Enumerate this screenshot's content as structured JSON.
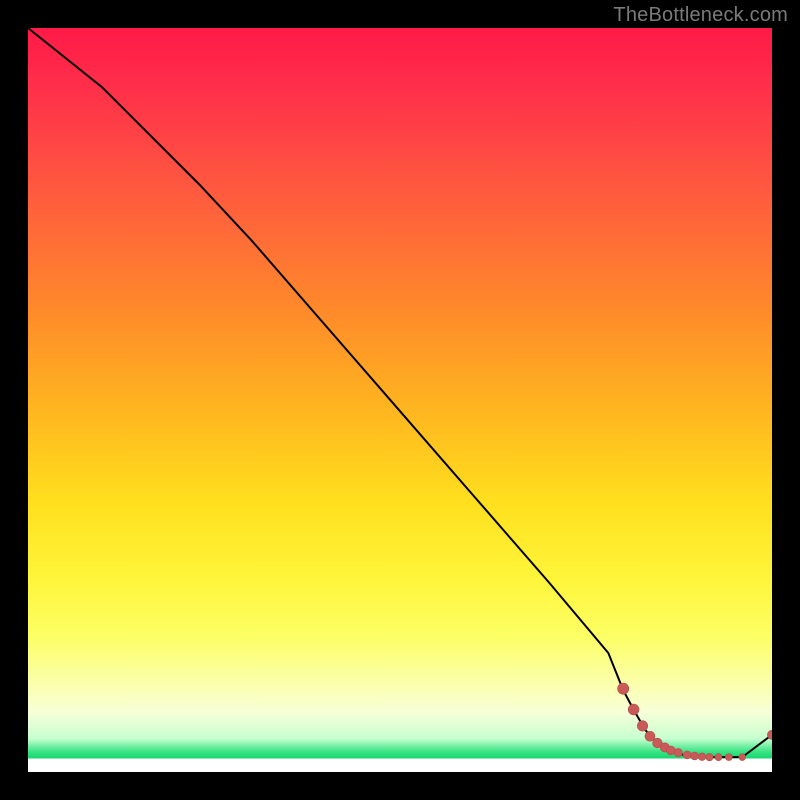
{
  "watermark": "TheBottleneck.com",
  "colors": {
    "line": "#000000",
    "markers": "#c95a57",
    "marker_stroke": "#b24c49",
    "bg_black": "#000000",
    "grad_top": "#ff1a47",
    "grad_mid": "#fff53a",
    "grad_green": "#16d76f"
  },
  "chart_data": {
    "type": "line",
    "title": "",
    "xlabel": "",
    "ylabel": "",
    "xlim": [
      0,
      100
    ],
    "ylim": [
      0,
      100
    ],
    "grid": false,
    "series": [
      {
        "name": "curve",
        "x": [
          0,
          10,
          23,
          30,
          40,
          50,
          60,
          70,
          78,
          80,
          81.5,
          83,
          84.3,
          85.5,
          87,
          88.5,
          90,
          91,
          92,
          93,
          94,
          95,
          96,
          100
        ],
        "values": [
          100,
          92,
          79,
          71.5,
          60,
          48.5,
          37,
          25.5,
          16,
          11,
          8.2,
          5.6,
          4.2,
          3.3,
          2.6,
          2.2,
          2.0,
          2.0,
          2.0,
          2.0,
          2.0,
          2.0,
          2.0,
          5.0
        ]
      }
    ],
    "markers": {
      "name": "cluster",
      "x": [
        80,
        81.4,
        82.6,
        83.6,
        84.6,
        85.6,
        86.4,
        87.4,
        88.6,
        89.6,
        90.6,
        91.6,
        92.8,
        94.2,
        96.0,
        100
      ],
      "values": [
        11.2,
        8.4,
        6.2,
        4.8,
        3.9,
        3.3,
        2.9,
        2.6,
        2.3,
        2.15,
        2.05,
        2.0,
        2.0,
        2.0,
        2.0,
        5.0
      ],
      "sizes": [
        5.6,
        5.4,
        5.2,
        5.0,
        4.8,
        4.6,
        4.4,
        4.2,
        4.0,
        3.9,
        3.8,
        3.7,
        3.6,
        3.5,
        3.4,
        4.6
      ]
    }
  }
}
